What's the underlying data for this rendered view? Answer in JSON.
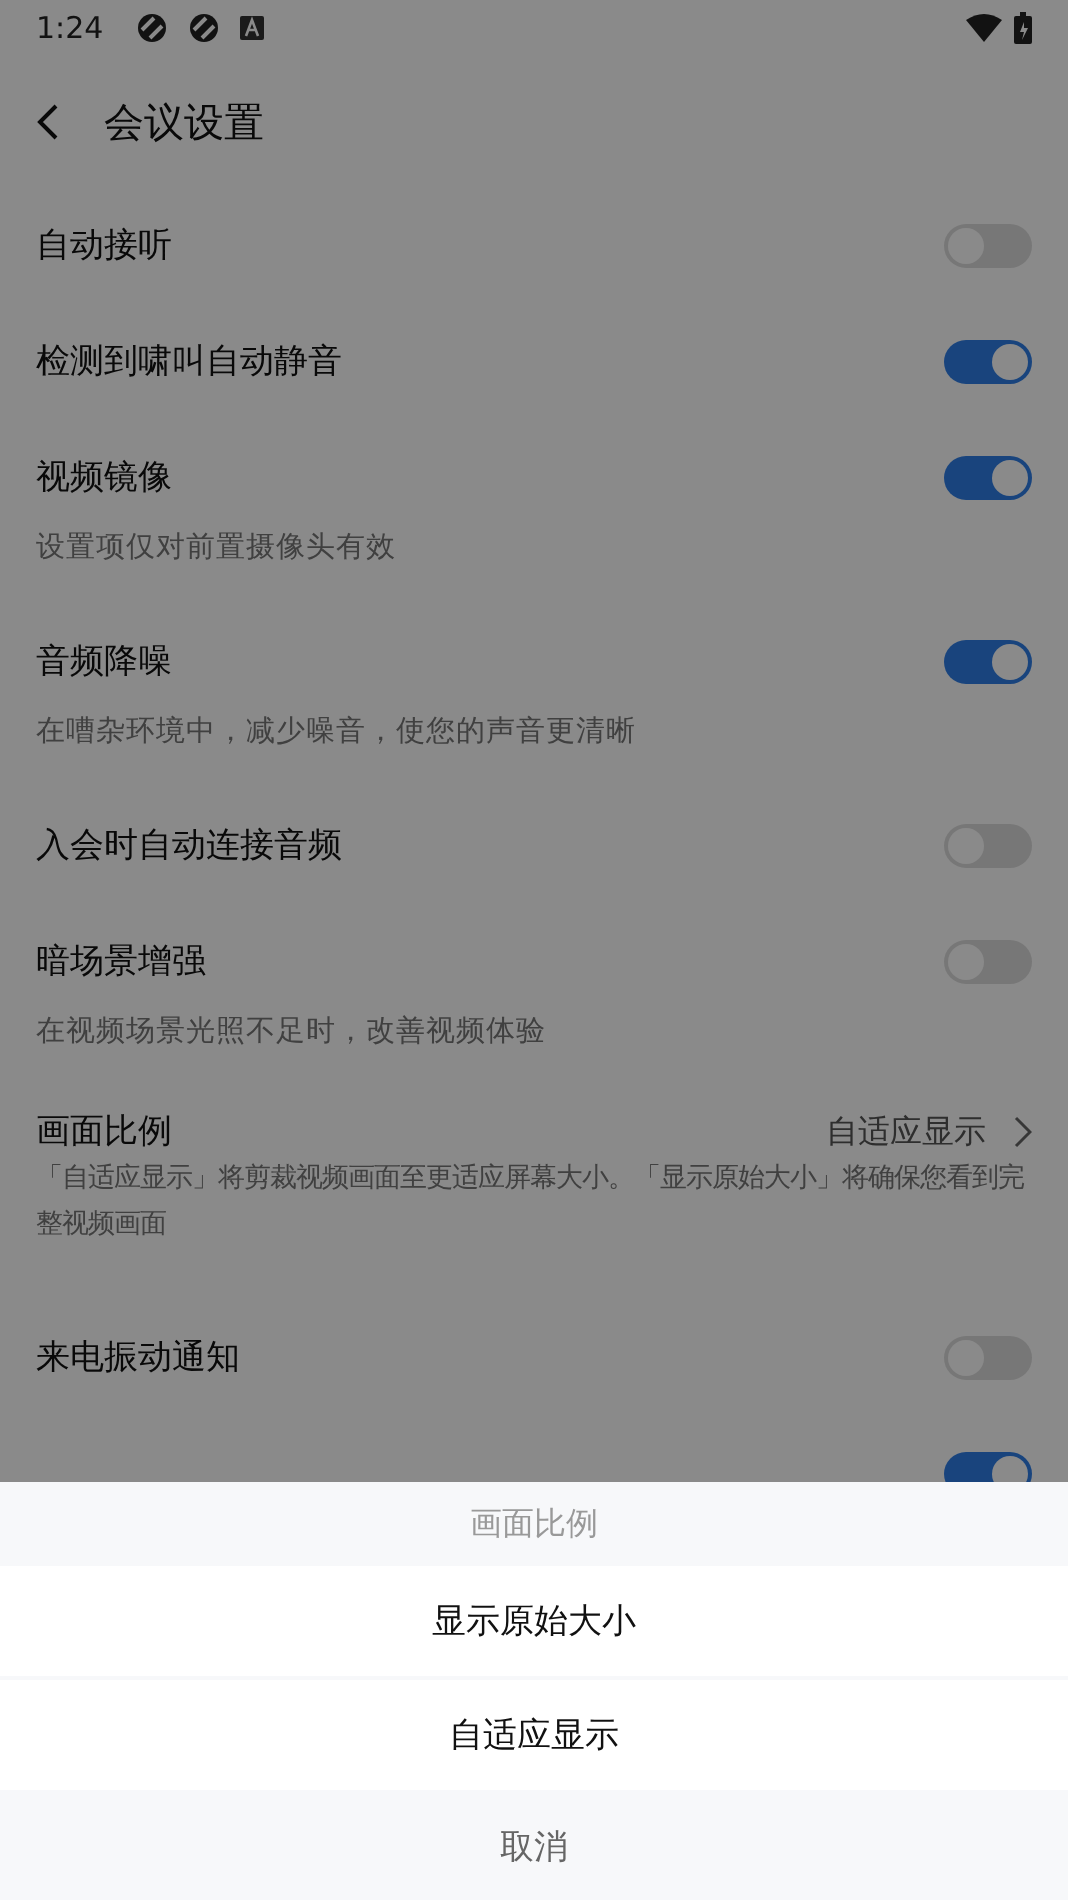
{
  "status_bar": {
    "time": "1:24"
  },
  "header": {
    "title": "会议设置"
  },
  "settings": [
    {
      "kind": "toggle",
      "label": "自动接听",
      "on": false
    },
    {
      "kind": "toggle",
      "label": "检测到啸叫自动静音",
      "on": true
    },
    {
      "kind": "toggle",
      "label": "视频镜像",
      "on": true,
      "description": "设置项仅对前置摄像头有效"
    },
    {
      "kind": "toggle",
      "label": "音频降噪",
      "on": true,
      "description": "在嘈杂环境中，减少噪音，使您的声音更清晰"
    },
    {
      "kind": "toggle",
      "label": "入会时自动连接音频",
      "on": false
    },
    {
      "kind": "toggle",
      "label": "暗场景增强",
      "on": false,
      "description": "在视频场景光照不足时，改善视频体验"
    },
    {
      "kind": "select",
      "label": "画面比例",
      "value": "自适应显示",
      "description": "「自适应显示」将剪裁视频画面至更适应屏幕大小。「显示原始大小」将确保您看到完整视频画面"
    },
    {
      "kind": "toggle",
      "label": "来电振动通知",
      "on": false
    },
    {
      "kind": "toggle",
      "on": true
    }
  ],
  "action_sheet": {
    "title": "画面比例",
    "options": [
      "显示原始大小",
      "自适应显示"
    ],
    "cancel": "取消"
  }
}
